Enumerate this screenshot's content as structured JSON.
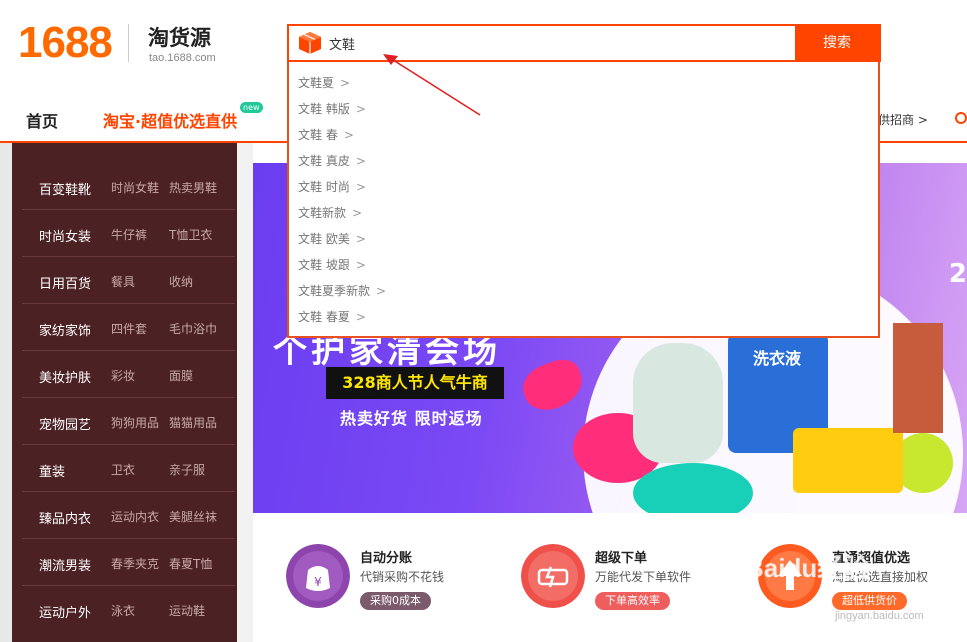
{
  "logo": {
    "number": "1688",
    "name": "淘货源",
    "url": "tao.1688.com"
  },
  "search": {
    "query": "文鞋",
    "button": "搜索"
  },
  "suggestions": [
    {
      "text": "文鞋夏",
      "chev": ">"
    },
    {
      "text": "文鞋 韩版",
      "chev": ">"
    },
    {
      "text": "文鞋 春",
      "chev": ">"
    },
    {
      "text": "文鞋 真皮",
      "chev": ">"
    },
    {
      "text": "文鞋 时尚",
      "chev": ">"
    },
    {
      "text": "文鞋新款",
      "chev": ">"
    },
    {
      "text": "文鞋 欧美",
      "chev": ">"
    },
    {
      "text": "文鞋 坡跟",
      "chev": ">"
    },
    {
      "text": "文鞋夏季新款",
      "chev": ">"
    },
    {
      "text": "文鞋 春夏",
      "chev": ">"
    }
  ],
  "nav": {
    "home": "首页",
    "taobao": "淘宝·超值优选直供",
    "new_badge": "new",
    "right": "供招商 >"
  },
  "categories": [
    {
      "name": "百变鞋靴",
      "sub1": "时尚女鞋",
      "sub2": "热卖男鞋"
    },
    {
      "name": "时尚女装",
      "sub1": "牛仔裤",
      "sub2": "T恤卫衣"
    },
    {
      "name": "日用百货",
      "sub1": "餐具",
      "sub2": "收纳"
    },
    {
      "name": "家纺家饰",
      "sub1": "四件套",
      "sub2": "毛巾浴巾"
    },
    {
      "name": "美妆护肤",
      "sub1": "彩妆",
      "sub2": "面膜"
    },
    {
      "name": "宠物园艺",
      "sub1": "狗狗用品",
      "sub2": "猫猫用品"
    },
    {
      "name": "童装",
      "sub1": "卫衣",
      "sub2": "亲子服"
    },
    {
      "name": "臻品内衣",
      "sub1": "运动内衣",
      "sub2": "美腿丝袜"
    },
    {
      "name": "潮流男装",
      "sub1": "春季夹克",
      "sub2": "春夏T恤"
    },
    {
      "name": "运动户外",
      "sub1": "泳衣",
      "sub2": "运动鞋"
    }
  ],
  "banner": {
    "title": "个护家清会场",
    "badge": "328商人节人气牛商",
    "sub": "热卖好货  限时返场",
    "corner": "2",
    "product_label": "洗衣液"
  },
  "features": [
    {
      "title": "自动分账",
      "desc": "代销采购不花钱",
      "pill": "采购0成本",
      "color": "#8e44ad",
      "pill_color": "#7b5b6b"
    },
    {
      "title": "超级下单",
      "desc": "万能代发下单软件",
      "pill": "下单高效率",
      "color": "#f0504a",
      "pill_color": "#ef5d5d"
    },
    {
      "title": "直通超值优选",
      "desc": "淘宝优选直接加权",
      "pill": "超低供货价",
      "color": "#ff5a1f",
      "pill_color": "#ff6a2a"
    }
  ],
  "watermark": {
    "text": "Baidu经验",
    "sub": "jingyan.baidu.com"
  }
}
